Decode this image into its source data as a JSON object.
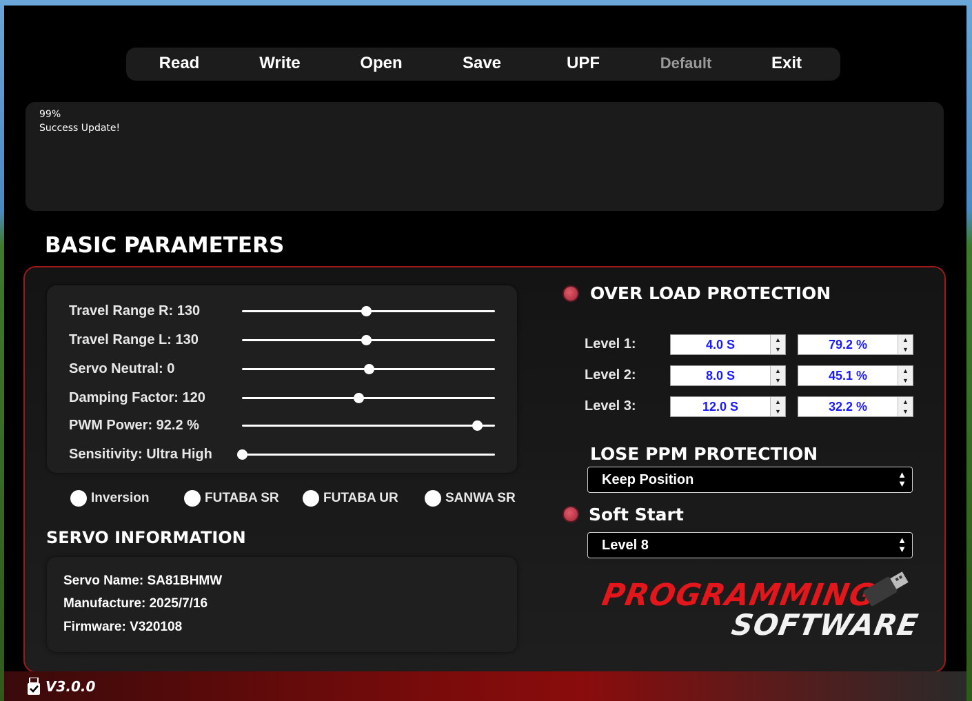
{
  "menu": {
    "read": "Read",
    "write": "Write",
    "open": "Open",
    "save": "Save",
    "upf": "UPF",
    "default": "Default",
    "exit": "Exit"
  },
  "log": {
    "line1": "99%",
    "line2": "Success Update!"
  },
  "basic_title": "BASIC PARAMETERS",
  "sliders": [
    {
      "label": "Travel Range R: 130",
      "value": 0.49
    },
    {
      "label": "Travel Range L: 130",
      "value": 0.49
    },
    {
      "label": "Servo Neutral: 0",
      "value": 0.5
    },
    {
      "label": "Damping Factor: 120",
      "value": 0.46
    },
    {
      "label": "PWM Power: 92.2 %",
      "value": 0.93
    },
    {
      "label": "Sensitivity: Ultra High",
      "value": 0.0
    }
  ],
  "radios": {
    "inversion": "Inversion",
    "futaba_sr": "FUTABA SR",
    "futaba_ur": "FUTABA UR",
    "sanwa_sr": "SANWA SR"
  },
  "servo_info": {
    "title": "SERVO INFORMATION",
    "name": "Servo Name: SA81BHMW",
    "manufacture": "Manufacture: 2025/7/16",
    "firmware": "Firmware: V320108"
  },
  "overload": {
    "title": "OVER LOAD PROTECTION",
    "levels": [
      {
        "label": "Level 1:",
        "time": "4.0 S",
        "percent": "79.2 %"
      },
      {
        "label": "Level 2:",
        "time": "8.0 S",
        "percent": "45.1 %"
      },
      {
        "label": "Level 3:",
        "time": "12.0 S",
        "percent": "32.2 %"
      }
    ]
  },
  "lose_ppm": {
    "title": "LOSE PPM PROTECTION",
    "selected": "Keep Position"
  },
  "soft_start": {
    "title": "Soft Start",
    "selected": "Level 8"
  },
  "logo": {
    "line1": "PROGRAMMING",
    "line2": "SOFTWARE"
  },
  "footer": {
    "version": "V3.0.0"
  },
  "colors": {
    "accent_red": "#e3161b",
    "spin_text": "#1a1aff",
    "led": "#c23a4a"
  }
}
